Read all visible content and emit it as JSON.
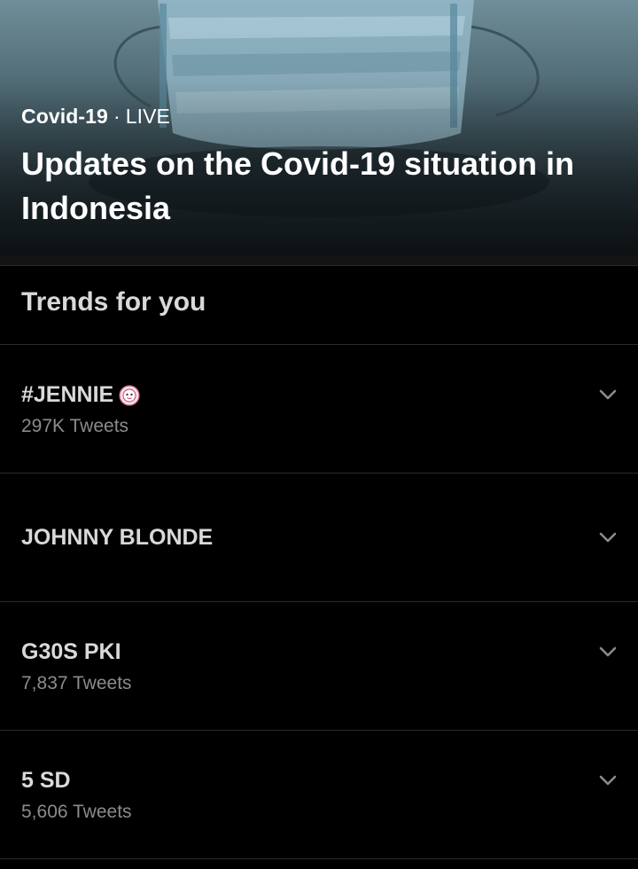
{
  "hero": {
    "topic": "Covid-19",
    "separator": "·",
    "status": "LIVE",
    "headline": "Updates on the Covid-19 situation in Indonesia"
  },
  "section": {
    "title": "Trends for you"
  },
  "trends": [
    {
      "name": "#JENNIE",
      "count": "297K Tweets",
      "badge_icon": "jennie-hashflag-icon"
    },
    {
      "name": "JOHNNY BLONDE",
      "count": ""
    },
    {
      "name": "G30S PKI",
      "count": "7,837 Tweets"
    },
    {
      "name": "5 SD",
      "count": "5,606 Tweets"
    }
  ],
  "colors": {
    "background": "#000000",
    "primary_text": "#d9d9d9",
    "secondary_text": "#8b8b8b",
    "divider": "#2b2b2b"
  }
}
